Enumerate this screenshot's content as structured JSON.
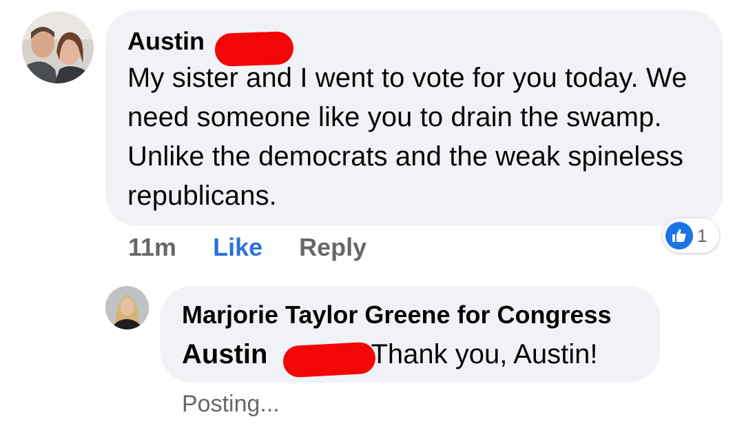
{
  "comment": {
    "author": "Austin",
    "text": "My sister and I went to vote for you today. We need someone like you to drain the swamp. Unlike the democrats and the weak spineless republicans.",
    "time": "11m",
    "like_label": "Like",
    "reply_label": "Reply",
    "reaction_count": "1",
    "reaction_icon": "thumbs-up-icon",
    "colors": {
      "like_blue": "#1b74e4",
      "redaction": "#f20707"
    }
  },
  "reply": {
    "author": "Marjorie Taylor Greene for Congress",
    "tagged": "Austin",
    "text": "Thank you, Austin!",
    "status": "Posting..."
  }
}
